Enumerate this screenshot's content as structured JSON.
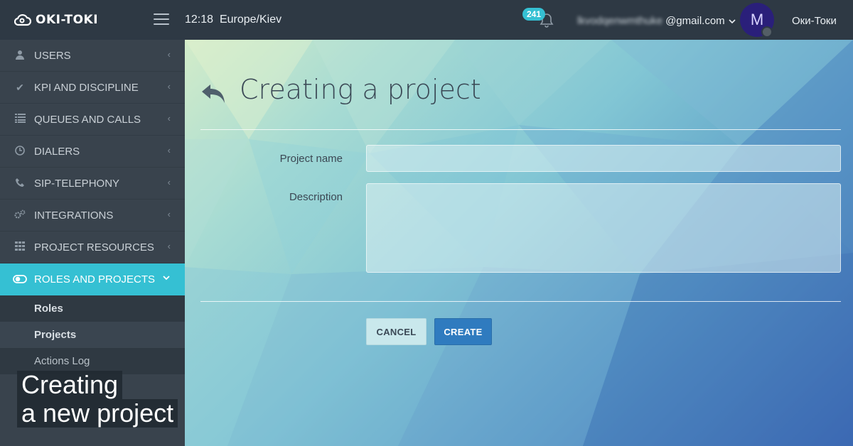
{
  "header": {
    "logo_text": "OKI-TOKI",
    "time": "12:18",
    "timezone": "Europe/Kiev",
    "notifications_count": "241",
    "email_masked": "lkvodqenwmthuke",
    "email_domain": "@gmail.com",
    "avatar_letter": "M",
    "username": "Оки-Токи"
  },
  "sidebar": {
    "items": [
      {
        "label": "USERS",
        "icon": "user-icon"
      },
      {
        "label": "KPI AND DISCIPLINE",
        "icon": "check-icon"
      },
      {
        "label": "QUEUES AND CALLS",
        "icon": "list-icon"
      },
      {
        "label": "DIALERS",
        "icon": "clock-icon"
      },
      {
        "label": "SIP-TELEPHONY",
        "icon": "phone-icon"
      },
      {
        "label": "INTEGRATIONS",
        "icon": "gears-icon"
      },
      {
        "label": "PROJECT RESOURCES",
        "icon": "grid-icon"
      },
      {
        "label": "ROLES AND PROJECTS",
        "icon": "toggle-icon",
        "active": true
      }
    ],
    "subitems": [
      {
        "label": "Roles"
      },
      {
        "label": "Projects",
        "current": true
      },
      {
        "label": "Actions Log"
      }
    ]
  },
  "caption": {
    "line1": "Creating",
    "line2": "a new project"
  },
  "main": {
    "title": "Creating a project",
    "form": {
      "project_name_label": "Project name",
      "project_name_value": "",
      "description_label": "Description",
      "description_value": ""
    },
    "buttons": {
      "cancel": "CANCEL",
      "create": "CREATE"
    }
  },
  "colors": {
    "accent": "#35c0d3",
    "primary_button": "#2f7bbf",
    "sidebar_bg": "#39434d",
    "topbar_bg": "#2e3944"
  }
}
